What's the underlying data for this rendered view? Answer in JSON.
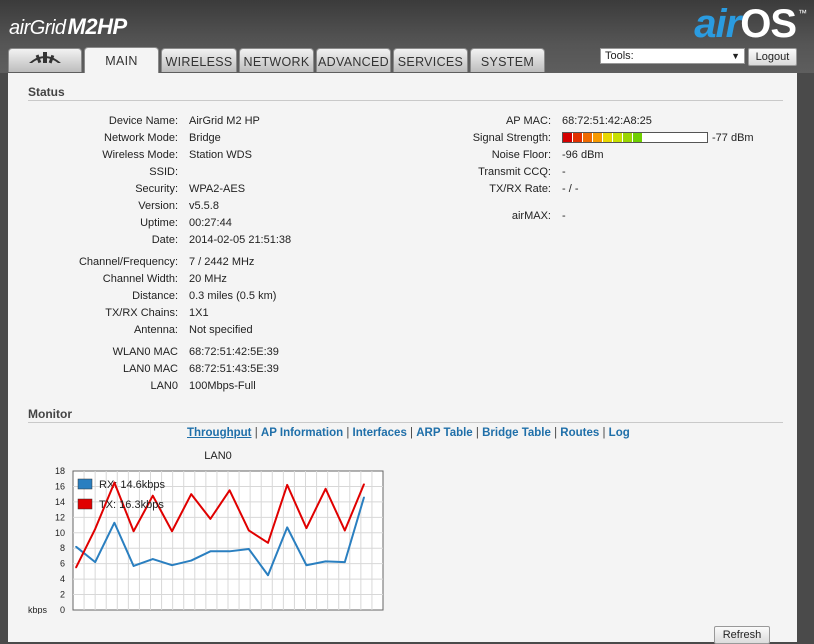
{
  "header": {
    "brand_prefix": "airGrid",
    "brand_model": "M2HP",
    "os_air": "air",
    "os_os": "OS",
    "os_tm": "™"
  },
  "tabs": [
    {
      "label": "",
      "icon": "ubiquiti-logo-icon"
    },
    {
      "label": "MAIN"
    },
    {
      "label": "WIRELESS"
    },
    {
      "label": "NETWORK"
    },
    {
      "label": "ADVANCED"
    },
    {
      "label": "SERVICES"
    },
    {
      "label": "SYSTEM"
    }
  ],
  "tools": {
    "selected": "Tools:"
  },
  "logout_label": "Logout",
  "status": {
    "title": "Status",
    "left": [
      {
        "label": "Device Name:",
        "value": "AirGrid M2 HP"
      },
      {
        "label": "Network Mode:",
        "value": "Bridge"
      },
      {
        "label": "Wireless Mode:",
        "value": "Station WDS"
      },
      {
        "label": "SSID:",
        "value": ""
      },
      {
        "label": "Security:",
        "value": "WPA2-AES"
      },
      {
        "label": "Version:",
        "value": "v5.5.8"
      },
      {
        "label": "Uptime:",
        "value": "00:27:44"
      },
      {
        "label": "Date:",
        "value": "2014-02-05 21:51:38"
      },
      {
        "label": "Channel/Frequency:",
        "value": "7 / 2442 MHz"
      },
      {
        "label": "Channel Width:",
        "value": "20 MHz"
      },
      {
        "label": "Distance:",
        "value": "0.3 miles (0.5 km)"
      },
      {
        "label": "TX/RX Chains:",
        "value": "1X1"
      },
      {
        "label": "Antenna:",
        "value": "Not specified"
      },
      {
        "label": "WLAN0 MAC",
        "value": "68:72:51:42:5E:39"
      },
      {
        "label": "LAN0 MAC",
        "value": "68:72:51:43:5E:39"
      },
      {
        "label": "LAN0",
        "value": "100Mbps-Full"
      }
    ],
    "right": [
      {
        "label": "AP MAC:",
        "value": "68:72:51:42:A8:25"
      },
      {
        "label": "Signal Strength:",
        "value": "-77 dBm"
      },
      {
        "label": "Noise Floor:",
        "value": "-96 dBm"
      },
      {
        "label": "Transmit CCQ:",
        "value": "-"
      },
      {
        "label": "TX/RX Rate:",
        "value": "- / -"
      },
      {
        "label": "airMAX:",
        "value": "-"
      }
    ],
    "signal_level": 0.55,
    "signal_colors": [
      "#d40000",
      "#e23000",
      "#ef6a00",
      "#f79a00",
      "#f7c400",
      "#e8d800",
      "#c8e000",
      "#9ad600",
      "#6fcf00",
      "#56c600"
    ]
  },
  "monitor": {
    "title": "Monitor",
    "links": [
      "Throughput",
      "AP Information",
      "Interfaces",
      "ARP Table",
      "Bridge Table",
      "Routes",
      "Log"
    ],
    "refresh_label": "Refresh"
  },
  "chart_data": {
    "type": "line",
    "title": "LAN0",
    "ylabel": "kbps",
    "ylim": [
      0,
      18
    ],
    "yticks": [
      0,
      2,
      4,
      6,
      8,
      10,
      12,
      14,
      16,
      18
    ],
    "x": [
      0,
      1,
      2,
      3,
      4,
      5,
      6,
      7,
      8,
      9,
      10,
      11,
      12,
      13,
      14,
      15,
      16
    ],
    "series": [
      {
        "name": "RX: 14.6kbps",
        "color": "#2a7fc0",
        "values": [
          8.2,
          6.2,
          11.3,
          5.7,
          6.6,
          5.8,
          6.4,
          7.6,
          7.6,
          7.9,
          4.5,
          10.7,
          5.8,
          6.3,
          6.2,
          14.6
        ]
      },
      {
        "name": "TX: 16.3kbps",
        "color": "#e00000",
        "values": [
          5.5,
          10.5,
          16.5,
          10.2,
          14.8,
          10.2,
          15.0,
          11.8,
          15.5,
          10.3,
          8.7,
          16.2,
          10.6,
          15.7,
          10.3,
          16.3
        ]
      }
    ]
  }
}
